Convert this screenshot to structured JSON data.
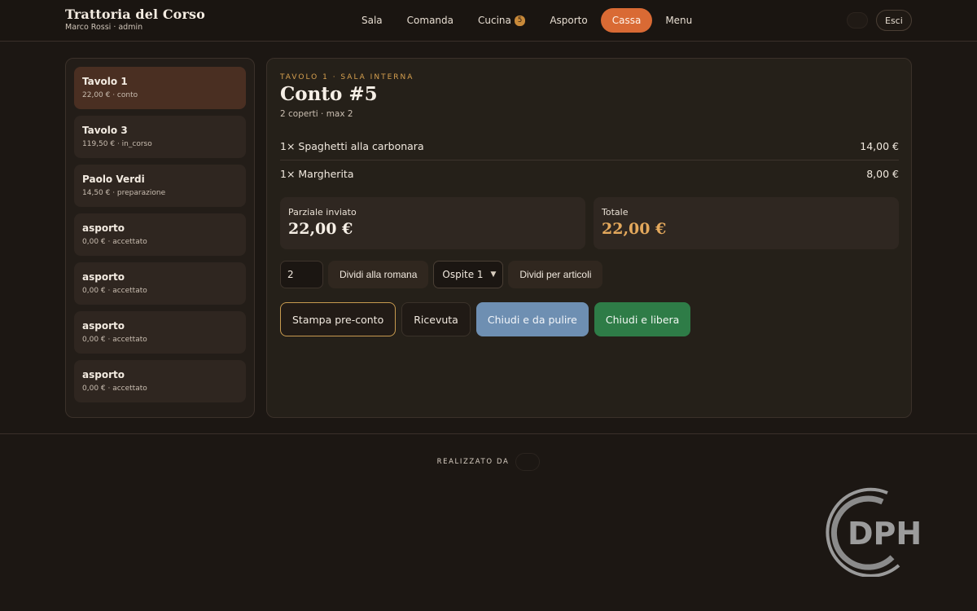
{
  "header": {
    "restaurant_name": "Trattoria del Corso",
    "user_line": "Marco Rossi · admin",
    "nav": [
      {
        "label": "Sala"
      },
      {
        "label": "Comanda"
      },
      {
        "label": "Cucina",
        "badge": "5"
      },
      {
        "label": "Asporto"
      },
      {
        "label": "Cassa",
        "active": true
      },
      {
        "label": "Menu"
      }
    ],
    "logout_label": "Esci"
  },
  "sidebar": {
    "tickets": [
      {
        "name": "Tavolo 1",
        "meta": "22,00 € · conto",
        "selected": true
      },
      {
        "name": "Tavolo 3",
        "meta": "119,50 € · in_corso"
      },
      {
        "name": "Paolo Verdi",
        "meta": "14,50 € · preparazione"
      },
      {
        "name": "asporto",
        "meta": "0,00 € · accettato"
      },
      {
        "name": "asporto",
        "meta": "0,00 € · accettato"
      },
      {
        "name": "asporto",
        "meta": "0,00 € · accettato"
      },
      {
        "name": "asporto",
        "meta": "0,00 € · accettato"
      }
    ]
  },
  "bill": {
    "eyebrow": "TAVOLO 1 · SALA INTERNA",
    "title": "Conto #5",
    "covers": "2 coperti · max 2",
    "lines": [
      {
        "item": "1× Spaghetti alla carbonara",
        "price": "14,00 €"
      },
      {
        "item": "1× Margherita",
        "price": "8,00 €"
      }
    ],
    "partial_label": "Parziale inviato",
    "partial_value": "22,00 €",
    "total_label": "Totale",
    "total_value": "22,00 €"
  },
  "split": {
    "guests_value": "2",
    "split_roman_label": "Dividi alla romana",
    "guest_select_value": "Ospite 1",
    "split_items_label": "Dividi per articoli"
  },
  "actions": {
    "preconto_label": "Stampa pre-conto",
    "receipt_label": "Ricevuta",
    "close_clean_label": "Chiudi e da pulire",
    "close_free_label": "Chiudi e libera"
  },
  "footer": {
    "made_by": "REALIZZATO DA"
  },
  "watermark": {
    "text": "DPH"
  },
  "colors": {
    "accent": "#d96a34",
    "gold": "#e3a85c",
    "blue_button": "#6e8fb2",
    "green_button": "#2e7c47"
  }
}
